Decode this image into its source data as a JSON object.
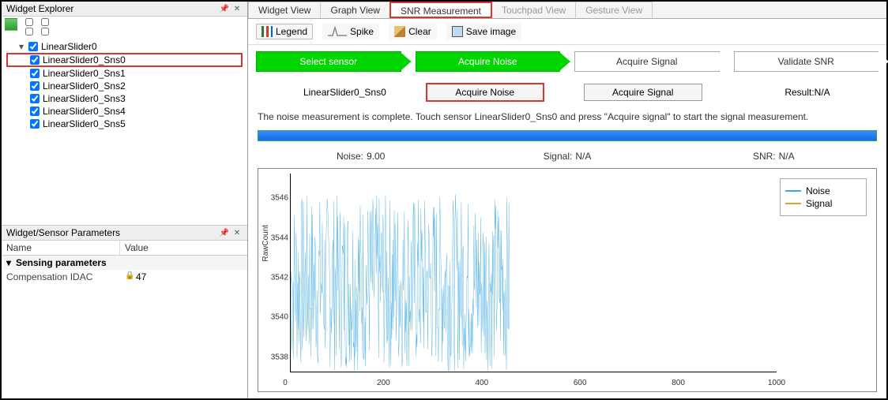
{
  "left": {
    "explorer_title": "Widget Explorer",
    "tree": {
      "root": "LinearSlider0",
      "items": [
        "LinearSlider0_Sns0",
        "LinearSlider0_Sns1",
        "LinearSlider0_Sns2",
        "LinearSlider0_Sns3",
        "LinearSlider0_Sns4",
        "LinearSlider0_Sns5"
      ]
    },
    "params_title": "Widget/Sensor Parameters",
    "params_cols": {
      "name": "Name",
      "value": "Value"
    },
    "params_group": "Sensing parameters",
    "params_rows": [
      {
        "name": "Compensation IDAC",
        "value": "47"
      }
    ]
  },
  "tabs": [
    "Widget View",
    "Graph View",
    "SNR Measurement",
    "Touchpad View",
    "Gesture View"
  ],
  "toolbar": {
    "legend": "Legend",
    "spike": "Spike",
    "clear": "Clear",
    "save": "Save image"
  },
  "flow": [
    "Select sensor",
    "Acquire Noise",
    "Acquire Signal",
    "Validate SNR"
  ],
  "controls": {
    "sensor": "LinearSlider0_Sns0",
    "btn_noise": "Acquire Noise",
    "btn_signal": "Acquire Signal",
    "result": "Result:N/A"
  },
  "status": "The noise measurement is complete. Touch sensor LinearSlider0_Sns0 and press \"Acquire signal\" to start the signal measurement.",
  "metrics": {
    "noise_k": "Noise:",
    "noise_v": "9.00",
    "signal_k": "Signal:",
    "signal_v": "N/A",
    "snr_k": "SNR:",
    "snr_v": "N/A"
  },
  "chart_data": {
    "type": "line",
    "xlabel": "",
    "ylabel": "RawCount",
    "xlim": [
      0,
      1000
    ],
    "ylim": [
      3537,
      3547
    ],
    "xticks": [
      0,
      200,
      400,
      600,
      800,
      1000
    ],
    "yticks": [
      3538,
      3540,
      3542,
      3544,
      3546
    ],
    "legend": [
      "Noise",
      "Signal"
    ],
    "series": [
      {
        "name": "Noise",
        "color": "#3ba7e0",
        "x_range": [
          0,
          450
        ],
        "n": 450,
        "base": 3541.5,
        "amp": 4.5,
        "note": "raw count noise ~3537–3546"
      },
      {
        "name": "Signal",
        "color": "#e0a030",
        "values": []
      }
    ]
  }
}
